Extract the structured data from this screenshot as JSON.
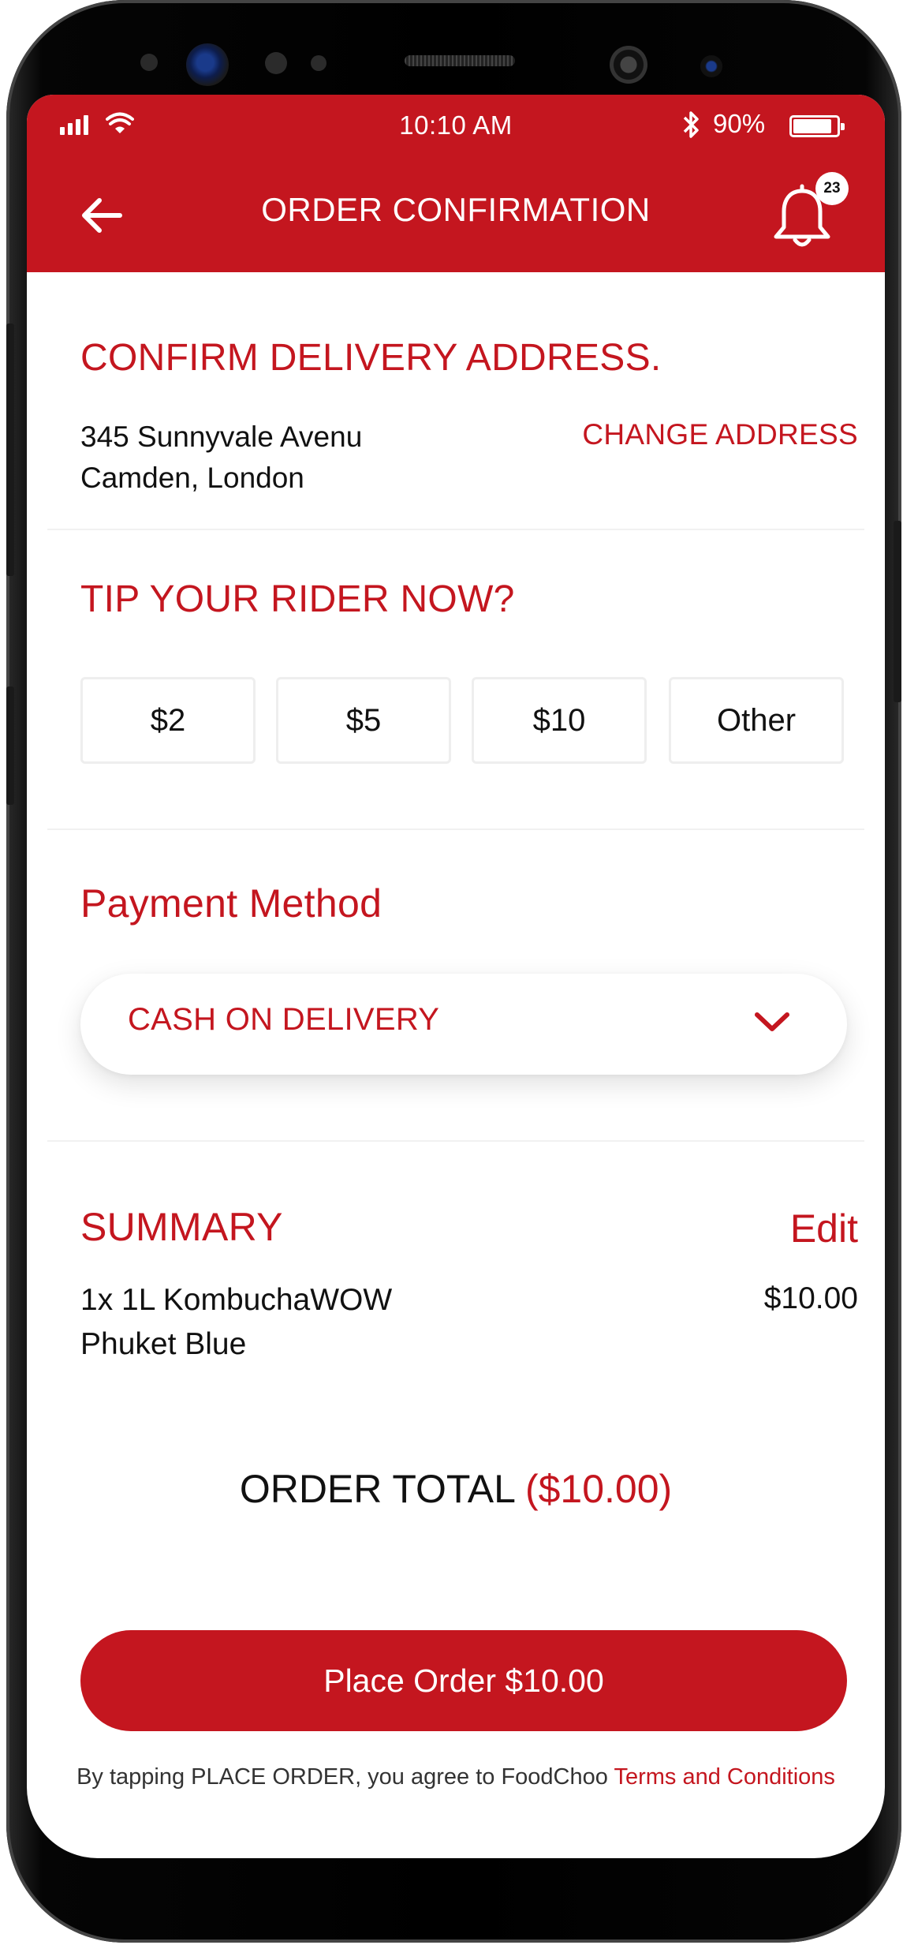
{
  "status_bar": {
    "time": "10:10 AM",
    "battery_pct": "90%",
    "battery_level": 0.9,
    "icons": [
      "signal-icon",
      "wifi-icon",
      "bluetooth-icon",
      "battery-icon"
    ]
  },
  "header": {
    "title": "ORDER CONFIRMATION",
    "back_icon": "arrow-left-icon",
    "bell_icon": "bell-icon",
    "notification_count": "23"
  },
  "address": {
    "title": "CONFIRM DELIVERY ADDRESS.",
    "line1": "345 Sunnyvale Avenu",
    "line2": "Camden, London",
    "change_label": "CHANGE ADDRESS"
  },
  "tip": {
    "title": "TIP YOUR RIDER NOW?",
    "options": [
      "$2",
      "$5",
      "$10",
      "Other"
    ]
  },
  "payment": {
    "title": "Payment Method",
    "selected": "CASH ON DELIVERY",
    "dropdown_icon": "chevron-down-icon"
  },
  "summary": {
    "title": "SUMMARY",
    "edit_label": "Edit",
    "items": [
      {
        "name_line1": "1x 1L KombuchaWOW",
        "name_line2": "Phuket Blue",
        "price": "$10.00"
      }
    ]
  },
  "total": {
    "label": "ORDER TOTAL",
    "value": "($10.00)"
  },
  "place_order_label": "Place Order $10.00",
  "terms": {
    "text": "By tapping PLACE ORDER, you agree to FoodChoo ",
    "link": "Terms and Conditions"
  },
  "colors": {
    "brand_red": "#c4161f",
    "text_dark": "#111111",
    "divider": "#f1f1f1"
  }
}
